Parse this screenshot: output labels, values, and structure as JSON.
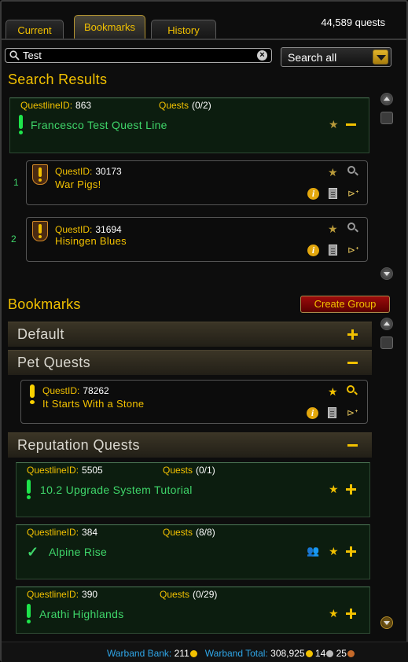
{
  "tabs": [
    {
      "label": "Current"
    },
    {
      "label": "Bookmarks"
    },
    {
      "label": "History"
    }
  ],
  "quest_count": "44,589 quests",
  "search": {
    "value": "Test",
    "placeholder": "",
    "scope": "Search all"
  },
  "results": {
    "title": "Search Results",
    "questline": {
      "id_label": "QuestlineID:",
      "id": "863",
      "quests_label": "Quests",
      "quests": "(0/2)",
      "name": "Francesco Test Quest Line"
    },
    "quests": [
      {
        "index": "1",
        "id_label": "QuestID:",
        "id": "30173",
        "name": "War Pigs!"
      },
      {
        "index": "2",
        "id_label": "QuestID:",
        "id": "31694",
        "name": "Hisingen Blues"
      }
    ]
  },
  "bookmarks": {
    "title": "Bookmarks",
    "create_group": "Create Group",
    "groups": [
      {
        "label": "Default"
      },
      {
        "label": "Pet Quests"
      },
      {
        "label": "Reputation Quests"
      }
    ],
    "pet_quest": {
      "id_label": "QuestID:",
      "id": "78262",
      "name": "It Starts With a Stone"
    },
    "questlines": [
      {
        "id_label": "QuestlineID:",
        "id": "5505",
        "quests_label": "Quests",
        "quests": "(0/1)",
        "name": "10.2 Upgrade System Tutorial"
      },
      {
        "id_label": "QuestlineID:",
        "id": "384",
        "quests_label": "Quests",
        "quests": "(8/8)",
        "name": "Alpine Rise"
      },
      {
        "id_label": "QuestlineID:",
        "id": "390",
        "quests_label": "Quests",
        "quests": "(0/29)",
        "name": "Arathi Highlands"
      }
    ]
  },
  "footer": {
    "bank_label": "Warband Bank:",
    "bank_gold": "211",
    "total_label": "Warband Total:",
    "total_gold": "308,925",
    "total_silver": "14",
    "total_copper": "25"
  },
  "colors": {
    "accent": "#f2c100",
    "questline_green": "#3fd66a",
    "footer_blue": "#2fa6e8",
    "button_red": "#9c0b0b"
  },
  "icons": [
    "search-icon",
    "clear-icon",
    "star-icon",
    "minus-icon",
    "plus-icon",
    "magnifier-icon",
    "info-icon",
    "document-icon",
    "horn-icon",
    "group-icon",
    "checkmark-icon",
    "exclamation-icon"
  ]
}
